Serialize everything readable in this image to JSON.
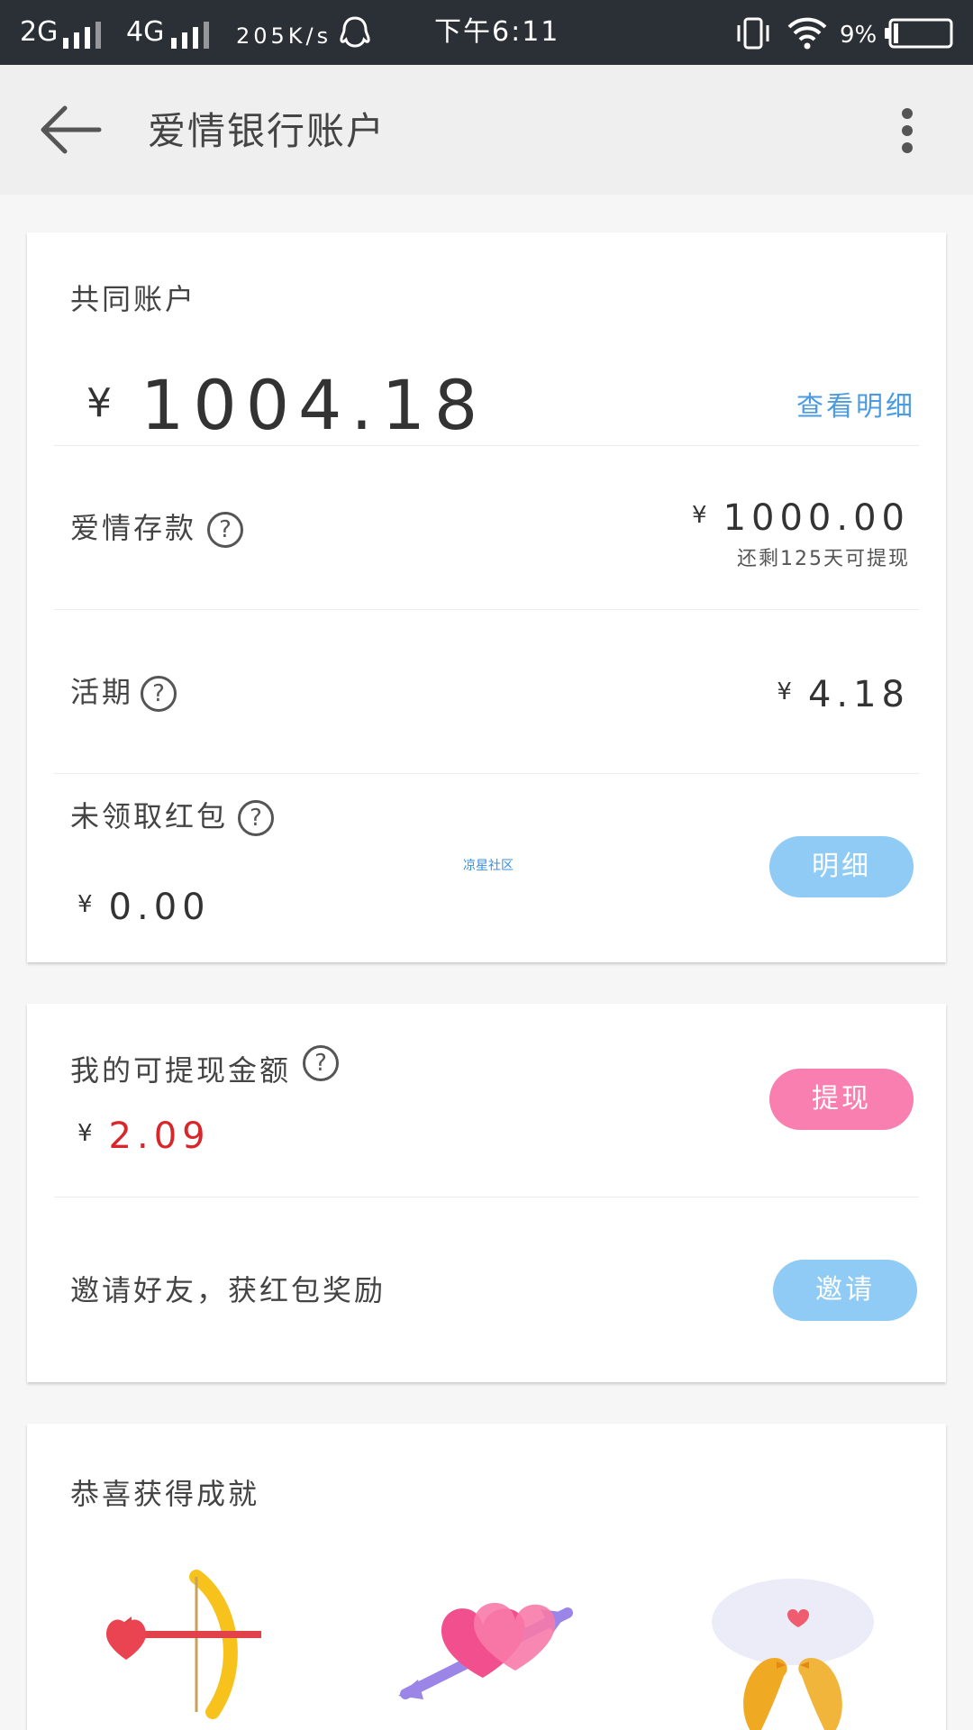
{
  "status_bar": {
    "network1": "2G",
    "network2": "4G",
    "speed": "205K/s",
    "time": "下午6:11",
    "battery": "9%"
  },
  "app_bar": {
    "title": "爱情银行账户",
    "icons": {
      "back": "back-arrow-icon",
      "menu": "more-vert-icon"
    }
  },
  "joint_account": {
    "title": "共同账户",
    "currency": "¥",
    "balance": "1004.18",
    "details_link": "查看明细",
    "love_deposit": {
      "label": "爱情存款",
      "amount": "1000.00",
      "note": "还剩125天可提现"
    },
    "current": {
      "label": "活期",
      "amount": "4.18"
    },
    "red_packet": {
      "label": "未领取红包",
      "amount": "0.00",
      "button": "明细"
    },
    "watermark": "凉星社区"
  },
  "withdraw": {
    "label": "我的可提现金额",
    "amount": "2.09",
    "button": "提现",
    "invite_text": "邀请好友，获红包奖励",
    "invite_button": "邀请"
  },
  "achievements": {
    "title": "恭喜获得成就",
    "badges": [
      "cupid-bow-icon",
      "arrow-hearts-icon",
      "love-birds-icon"
    ]
  },
  "help_glyph": "?",
  "colors": {
    "status_bar": "#2b2f36",
    "app_bar": "#efefef",
    "link_blue": "#4b9be0",
    "pill_blue": "#8fcbf5",
    "pill_pink": "#f97fb0",
    "amount_red": "#d8262b"
  }
}
